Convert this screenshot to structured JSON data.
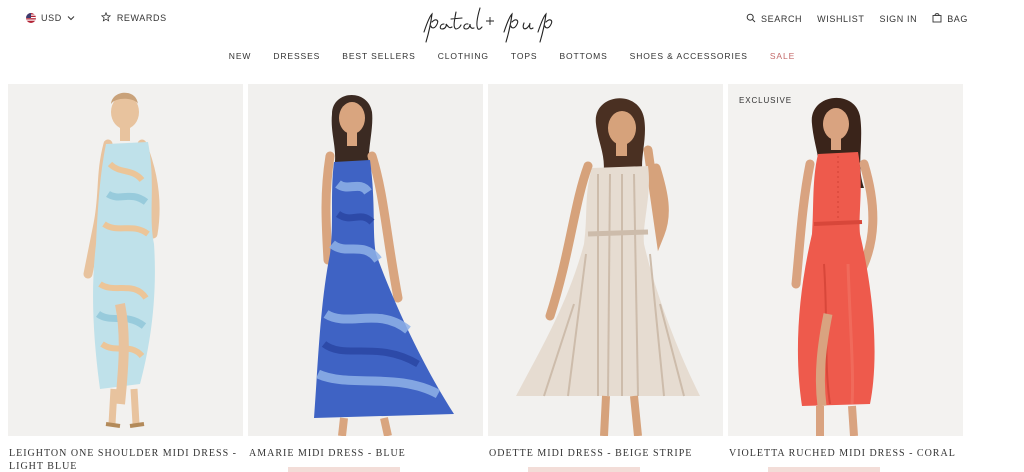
{
  "header": {
    "currency": "USD",
    "rewards": "REWARDS",
    "search": "SEARCH",
    "wishlist": "WISHLIST",
    "signin": "SIGN IN",
    "bag": "BAG",
    "logo_text": "petal + pup"
  },
  "nav": {
    "items": [
      "NEW",
      "DRESSES",
      "BEST SELLERS",
      "CLOTHING",
      "TOPS",
      "BOTTOMS",
      "SHOES & ACCESSORIES",
      "SALE"
    ]
  },
  "products": [
    {
      "name": "LEIGHTON ONE SHOULDER MIDI DRESS - LIGHT BLUE",
      "badge": "",
      "colors": [
        "#bfe1ea",
        "#f3c08a",
        "#8fc5d8"
      ]
    },
    {
      "name": "AMARIE MIDI DRESS - BLUE",
      "badge": "",
      "colors": [
        "#3f63c4",
        "#8fb1e8",
        "#2d4aa8"
      ]
    },
    {
      "name": "ODETTE MIDI DRESS - BEIGE STRIPE",
      "badge": "",
      "colors": [
        "#e6dcd1",
        "#cdbcab",
        "#f4efe9"
      ]
    },
    {
      "name": "VIOLETTA RUCHED MIDI DRESS - CORAL",
      "badge": "EXCLUSIVE",
      "colors": [
        "#ee5a4c",
        "#f06a5b",
        "#d8473a"
      ]
    }
  ],
  "accent_colors": {
    "sale": "#c46a6a",
    "price_placeholder": "#f3ddd8"
  }
}
